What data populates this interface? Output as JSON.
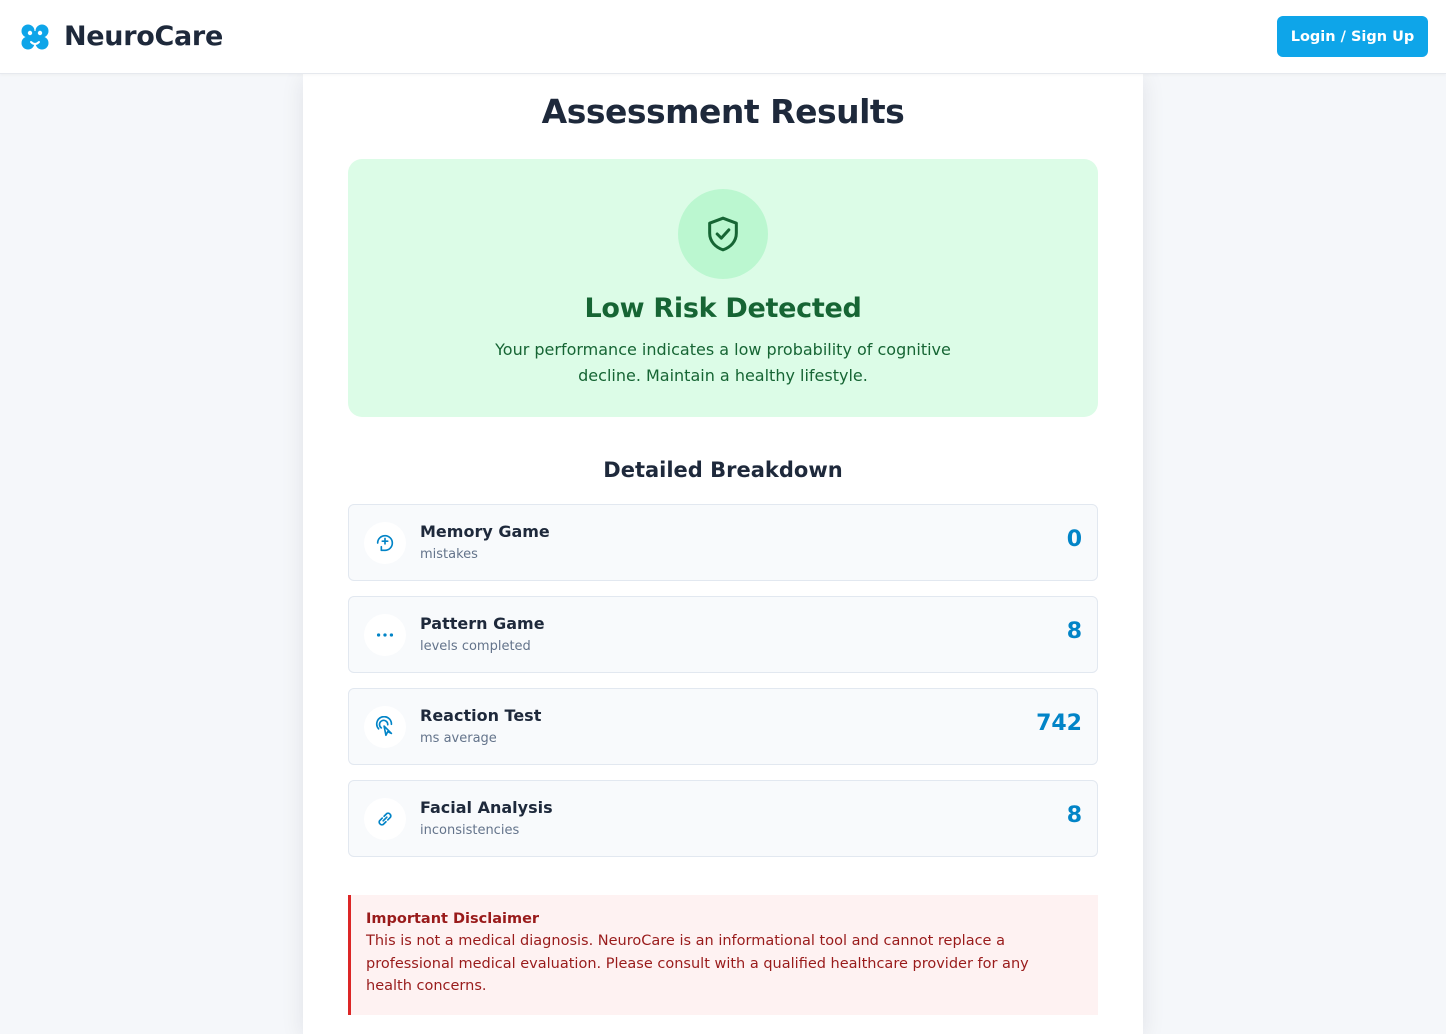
{
  "navbar": {
    "brand_name": "NeuroCare",
    "logo_icon": "brain-logo-icon",
    "login_label": "Login / Sign Up"
  },
  "page": {
    "title": "Assessment Results"
  },
  "risk": {
    "icon": "shield-check-icon",
    "title": "Low Risk Detected",
    "description": "Your performance indicates a low probability of cognitive decline. Maintain a healthy lifestyle."
  },
  "breakdown": {
    "title": "Detailed Breakdown",
    "items": [
      {
        "name": "Memory Game",
        "unit": "mistakes",
        "value": "0",
        "icon": "brain-icon"
      },
      {
        "name": "Pattern Game",
        "unit": "levels completed",
        "value": "8",
        "icon": "dots-icon"
      },
      {
        "name": "Reaction Test",
        "unit": "ms average",
        "value": "742",
        "icon": "pointer-click-icon"
      },
      {
        "name": "Facial Analysis",
        "unit": "inconsistencies",
        "value": "8",
        "icon": "link-icon"
      }
    ]
  },
  "disclaimer": {
    "title": "Important Disclaimer",
    "text": "This is not a medical diagnosis. NeuroCare is an informational tool and cannot replace a professional medical evaluation. Please consult with a qualified healthcare provider for any health concerns."
  },
  "colors": {
    "accent": "#0ea5e9",
    "value_blue": "#0284c7",
    "success_bg": "#dcfce7",
    "success_text": "#166534",
    "danger_bg": "#fef2f2",
    "danger_text": "#991b1b"
  }
}
